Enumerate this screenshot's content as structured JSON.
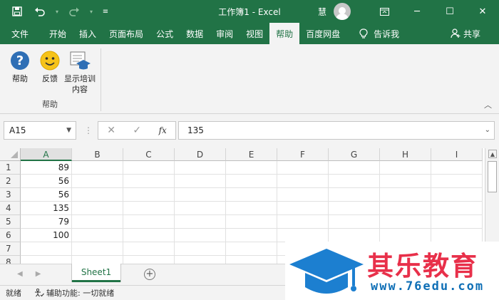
{
  "titlebar": {
    "title": "工作簿1  -  Excel",
    "user": "慧",
    "colors": {
      "brand": "#217346"
    },
    "qat_icons": [
      "save-icon",
      "undo-icon",
      "redo-icon",
      "customize-qat-icon"
    ],
    "window_icons": [
      "ribbon-display-icon",
      "minimize-icon",
      "maximize-icon",
      "close-icon"
    ]
  },
  "tabs": {
    "items": [
      "文件",
      "开始",
      "插入",
      "页面布局",
      "公式",
      "数据",
      "审阅",
      "视图",
      "帮助",
      "百度网盘"
    ],
    "active": "帮助",
    "tell_me": "告诉我",
    "share": "共享"
  },
  "ribbon": {
    "group_label": "帮助",
    "buttons": [
      {
        "label": "帮助",
        "icon": "help-icon"
      },
      {
        "label": "反馈",
        "icon": "smiley-icon"
      },
      {
        "label": "显示培训内容",
        "icon": "training-icon"
      }
    ]
  },
  "formula_bar": {
    "name_box": "A15",
    "value": "135"
  },
  "grid": {
    "columns": [
      "A",
      "B",
      "C",
      "D",
      "E",
      "F",
      "G",
      "H",
      "I"
    ],
    "rows": [
      "1",
      "2",
      "3",
      "4",
      "5",
      "6",
      "7",
      "8"
    ],
    "column_a_values": [
      "89",
      "56",
      "56",
      "135",
      "79",
      "100",
      "",
      ""
    ]
  },
  "sheets": {
    "tabs": [
      "Sheet1"
    ],
    "active": "Sheet1"
  },
  "status": {
    "ready": "就绪",
    "accessibility": "辅助功能: 一切就绪"
  },
  "watermark": {
    "name": "其乐教育",
    "url": "www.76edu.com",
    "colors": {
      "name": "#e8304a",
      "url": "#0f6fb6"
    }
  }
}
